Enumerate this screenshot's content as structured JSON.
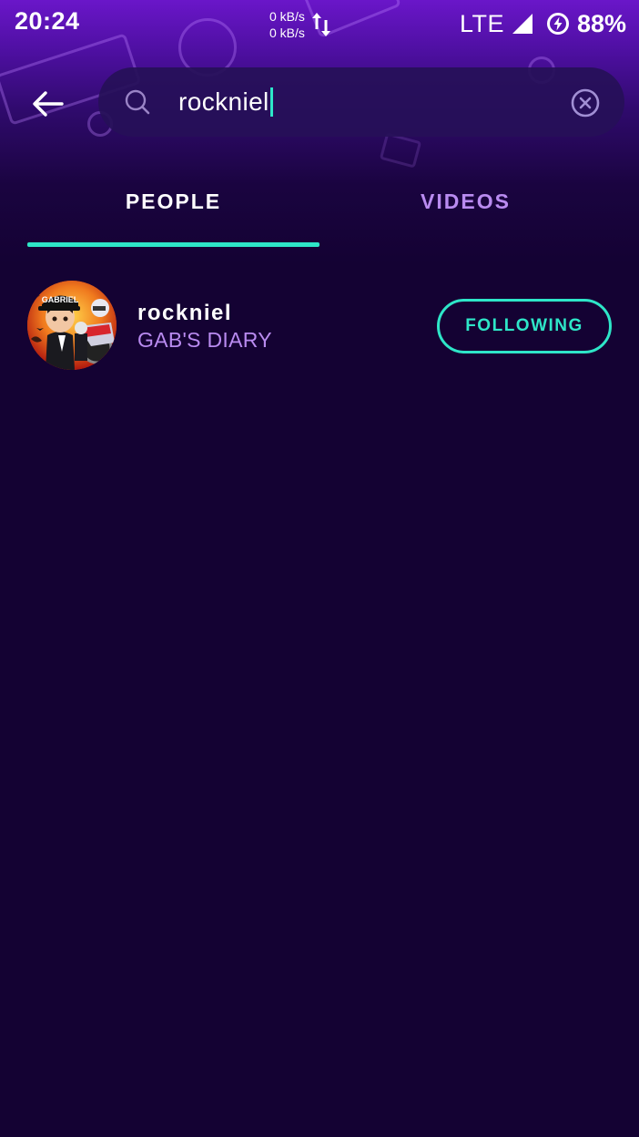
{
  "status_bar": {
    "time": "20:24",
    "net_up": "0 kB/s",
    "net_down": "0 kB/s",
    "network": "LTE",
    "battery": "88%"
  },
  "search": {
    "query": "rockniel"
  },
  "tabs": [
    {
      "label": "PEOPLE",
      "active": true
    },
    {
      "label": "VIDEOS",
      "active": false
    }
  ],
  "results": [
    {
      "username": "rockniel",
      "subtitle": "GAB'S DIARY",
      "avatar_text": "GABRIEL",
      "follow_label": "FOLLOWING"
    }
  ],
  "colors": {
    "background": "#140233",
    "accent": "#2ee6c8",
    "secondary_text": "#b98bf0",
    "header_top": "#6a16c9"
  },
  "icons": {
    "back": "arrow-left-icon",
    "search": "search-icon",
    "clear": "clear-circle-icon",
    "signal": "signal-icon",
    "battery": "battery-saver-icon",
    "data_transfer": "up-down-arrows-icon"
  }
}
